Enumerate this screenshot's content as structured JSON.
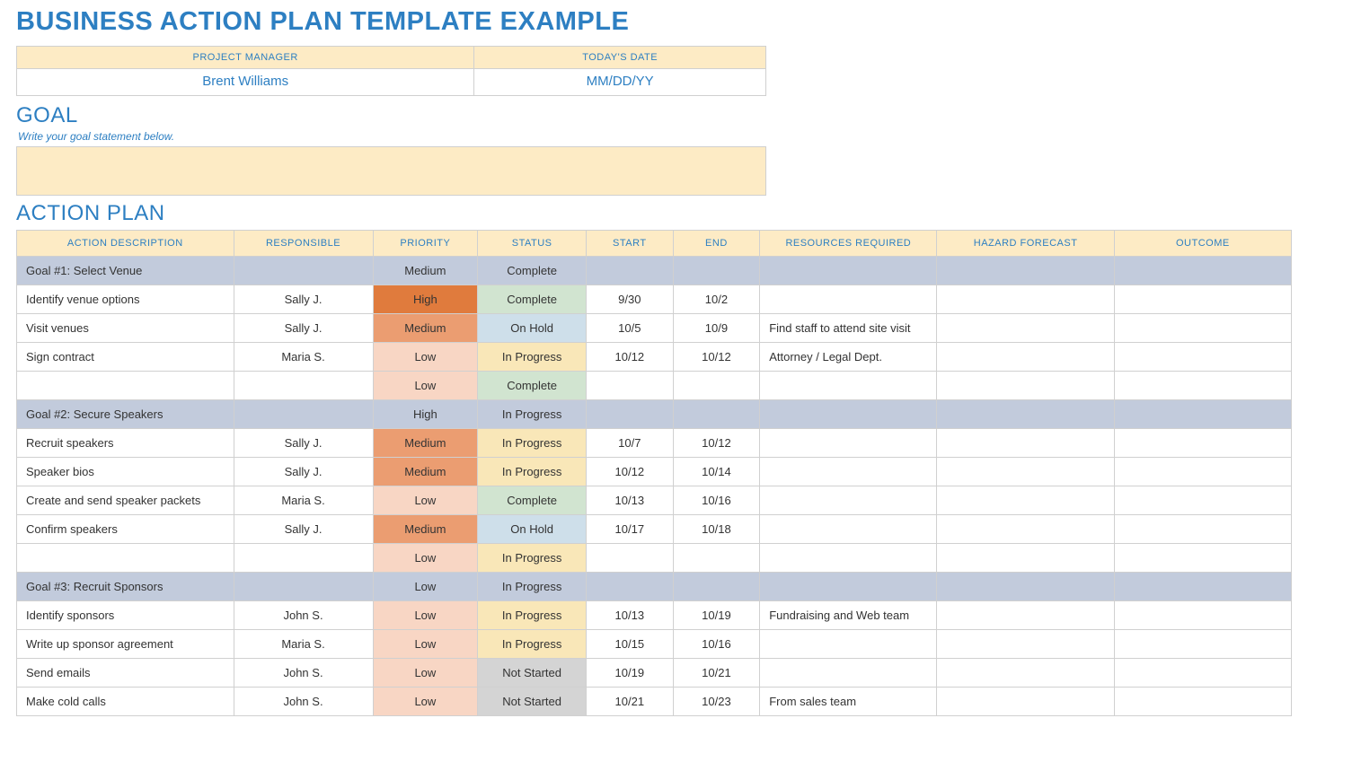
{
  "title": "BUSINESS ACTION PLAN TEMPLATE EXAMPLE",
  "info": {
    "pm_label": "PROJECT MANAGER",
    "pm_value": "Brent Williams",
    "date_label": "TODAY'S DATE",
    "date_value": "MM/DD/YY"
  },
  "goal": {
    "heading": "GOAL",
    "hint": "Write your goal statement below."
  },
  "plan": {
    "heading": "ACTION PLAN",
    "columns": {
      "desc": "ACTION DESCRIPTION",
      "resp": "RESPONSIBLE",
      "pri": "PRIORITY",
      "stat": "STATUS",
      "start": "START",
      "end": "END",
      "res": "RESOURCES REQUIRED",
      "haz": "HAZARD FORECAST",
      "out": "OUTCOME"
    },
    "rows": [
      {
        "group": true,
        "desc": "Goal #1:  Select Venue",
        "resp": "",
        "pri": "Medium",
        "stat": "Complete",
        "start": "",
        "end": "",
        "res": "",
        "haz": "",
        "out": ""
      },
      {
        "group": false,
        "desc": "Identify venue options",
        "resp": "Sally J.",
        "pri": "High",
        "stat": "Complete",
        "start": "9/30",
        "end": "10/2",
        "res": "",
        "haz": "",
        "out": ""
      },
      {
        "group": false,
        "desc": "Visit venues",
        "resp": "Sally J.",
        "pri": "Medium",
        "stat": "On Hold",
        "start": "10/5",
        "end": "10/9",
        "res": "Find staff to attend site visit",
        "haz": "",
        "out": ""
      },
      {
        "group": false,
        "desc": "Sign contract",
        "resp": "Maria S.",
        "pri": "Low",
        "stat": "In Progress",
        "start": "10/12",
        "end": "10/12",
        "res": "Attorney / Legal Dept.",
        "haz": "",
        "out": ""
      },
      {
        "group": false,
        "desc": "",
        "resp": "",
        "pri": "Low",
        "stat": "Complete",
        "start": "",
        "end": "",
        "res": "",
        "haz": "",
        "out": ""
      },
      {
        "group": true,
        "desc": "Goal #2: Secure Speakers",
        "resp": "",
        "pri": "High",
        "stat": "In Progress",
        "start": "",
        "end": "",
        "res": "",
        "haz": "",
        "out": ""
      },
      {
        "group": false,
        "desc": "Recruit speakers",
        "resp": "Sally J.",
        "pri": "Medium",
        "stat": "In Progress",
        "start": "10/7",
        "end": "10/12",
        "res": "",
        "haz": "",
        "out": ""
      },
      {
        "group": false,
        "desc": "Speaker bios",
        "resp": "Sally J.",
        "pri": "Medium",
        "stat": "In Progress",
        "start": "10/12",
        "end": "10/14",
        "res": "",
        "haz": "",
        "out": ""
      },
      {
        "group": false,
        "desc": "Create and send speaker packets",
        "resp": "Maria S.",
        "pri": "Low",
        "stat": "Complete",
        "start": "10/13",
        "end": "10/16",
        "res": "",
        "haz": "",
        "out": ""
      },
      {
        "group": false,
        "desc": "Confirm speakers",
        "resp": "Sally J.",
        "pri": "Medium",
        "stat": "On Hold",
        "start": "10/17",
        "end": "10/18",
        "res": "",
        "haz": "",
        "out": ""
      },
      {
        "group": false,
        "desc": "",
        "resp": "",
        "pri": "Low",
        "stat": "In Progress",
        "start": "",
        "end": "",
        "res": "",
        "haz": "",
        "out": ""
      },
      {
        "group": true,
        "desc": "Goal #3: Recruit Sponsors",
        "resp": "",
        "pri": "Low",
        "stat": "In Progress",
        "start": "",
        "end": "",
        "res": "",
        "haz": "",
        "out": ""
      },
      {
        "group": false,
        "desc": "Identify sponsors",
        "resp": "John S.",
        "pri": "Low",
        "stat": "In Progress",
        "start": "10/13",
        "end": "10/19",
        "res": "Fundraising and Web team",
        "haz": "",
        "out": ""
      },
      {
        "group": false,
        "desc": "Write up sponsor agreement",
        "resp": "Maria S.",
        "pri": "Low",
        "stat": "In Progress",
        "start": "10/15",
        "end": "10/16",
        "res": "",
        "haz": "",
        "out": ""
      },
      {
        "group": false,
        "desc": "Send emails",
        "resp": "John S.",
        "pri": "Low",
        "stat": "Not Started",
        "start": "10/19",
        "end": "10/21",
        "res": "",
        "haz": "",
        "out": ""
      },
      {
        "group": false,
        "desc": "Make cold calls",
        "resp": "John S.",
        "pri": "Low",
        "stat": "Not Started",
        "start": "10/21",
        "end": "10/23",
        "res": "From sales team",
        "haz": "",
        "out": ""
      }
    ]
  }
}
